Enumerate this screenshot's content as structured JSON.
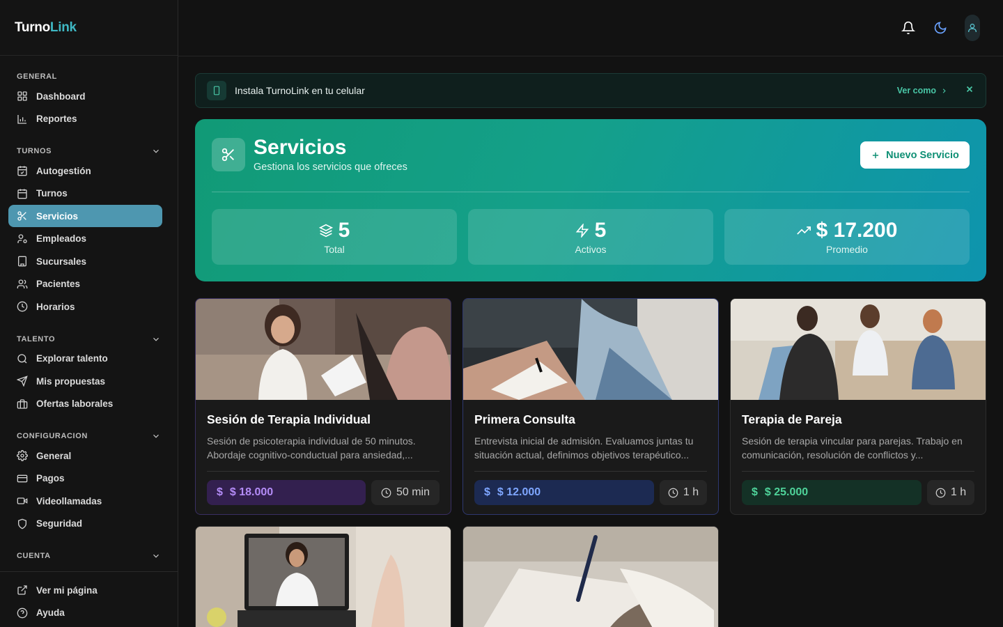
{
  "brand": {
    "part1": "Turno",
    "part2": "Link"
  },
  "sidebar": {
    "sections": [
      {
        "title": "GENERAL",
        "items": [
          "Dashboard",
          "Reportes"
        ]
      },
      {
        "title": "TURNOS",
        "items": [
          "Autogestión",
          "Turnos",
          "Servicios",
          "Empleados",
          "Sucursales",
          "Pacientes",
          "Horarios"
        ]
      },
      {
        "title": "TALENTO",
        "items": [
          "Explorar talento",
          "Mis propuestas",
          "Ofertas laborales"
        ]
      },
      {
        "title": "CONFIGURACION",
        "items": [
          "General",
          "Pagos",
          "Videollamadas",
          "Seguridad"
        ]
      },
      {
        "title": "CUENTA",
        "items": []
      }
    ],
    "active_item": "Servicios",
    "bottom": [
      "Ver mi página",
      "Ayuda"
    ]
  },
  "header": {
    "icons": [
      "bell-icon",
      "moon-icon",
      "user-icon"
    ]
  },
  "banner": {
    "text": "Instala TurnoLink en tu celular",
    "action": "Ver como"
  },
  "hero": {
    "title": "Servicios",
    "subtitle": "Gestiona los servicios que ofreces",
    "button": "Nuevo Servicio",
    "stats": [
      {
        "value": "5",
        "label": "Total",
        "icon": "layers-icon"
      },
      {
        "value": "5",
        "label": "Activos",
        "icon": "zap-icon"
      },
      {
        "value": "$ 17.200",
        "label": "Promedio",
        "icon": "trending-up-icon"
      }
    ]
  },
  "services": [
    {
      "name": "Sesión de Terapia Individual",
      "desc": "Sesión de psicoterapia individual de 50 minutos. Abordaje cognitivo-conductual para ansiedad,...",
      "price": "$ 18.000",
      "duration": "50 min",
      "accent": "#b48cf7"
    },
    {
      "name": "Primera Consulta",
      "desc": "Entrevista inicial de admisión. Evaluamos juntas tu situación actual, definimos objetivos terapéutico...",
      "price": "$ 12.000",
      "duration": "1 h",
      "accent": "#7ea6ff"
    },
    {
      "name": "Terapia de Pareja",
      "desc": "Sesión de terapia vincular para parejas. Trabajo en comunicación, resolución de conflictos y...",
      "price": "$ 25.000",
      "duration": "1 h",
      "accent": "#4fd39a"
    }
  ],
  "colors": {
    "accent_teal": "#14a08a",
    "active_nav": "#4e97b0",
    "background": "#121212"
  }
}
